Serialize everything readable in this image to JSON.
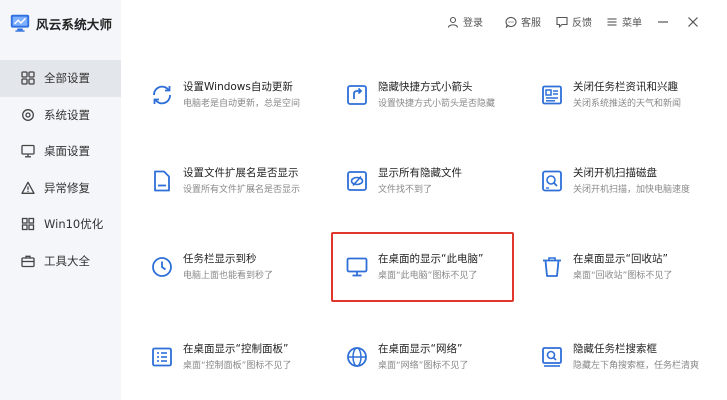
{
  "app": {
    "title": "风云系统大师",
    "brand_color": "#2f6fe0"
  },
  "topbar": {
    "login": "登录",
    "service": "客服",
    "feedback": "反馈",
    "menu": "菜单"
  },
  "sidebar": {
    "items": [
      {
        "label": "全部设置",
        "icon": "grid-icon",
        "active": true
      },
      {
        "label": "系统设置",
        "icon": "gear-icon",
        "active": false
      },
      {
        "label": "桌面设置",
        "icon": "monitor-icon",
        "active": false
      },
      {
        "label": "异常修复",
        "icon": "warning-icon",
        "active": false
      },
      {
        "label": "Win10优化",
        "icon": "windows-icon",
        "active": false
      },
      {
        "label": "工具大全",
        "icon": "toolbox-icon",
        "active": false
      }
    ]
  },
  "cards": [
    {
      "title": "设置Windows自动更新",
      "desc": "电脑老是自动更新，总是空间",
      "icon": "refresh-icon"
    },
    {
      "title": "隐藏快捷方式小箭头",
      "desc": "设置快捷方式小箭头是否隐藏",
      "icon": "shortcut-arrow-icon"
    },
    {
      "title": "关闭任务栏资讯和兴趣",
      "desc": "关闭系统推送的天气和新闻",
      "icon": "news-icon"
    },
    {
      "title": "设置文件扩展名是否显示",
      "desc": "设置所有文件扩展名是否显示",
      "icon": "file-icon"
    },
    {
      "title": "显示所有隐藏文件",
      "desc": "文件找不到了",
      "icon": "hidden-file-icon"
    },
    {
      "title": "关闭开机扫描磁盘",
      "desc": "关闭开机扫描，加快电脑速度",
      "icon": "disk-scan-icon"
    },
    {
      "title": "任务栏显示到秒",
      "desc": "电脑上面也能看到秒了",
      "icon": "clock-icon"
    },
    {
      "title": "在桌面的显示“此电脑”",
      "desc": "桌面“此电脑”图标不见了",
      "icon": "this-pc-icon"
    },
    {
      "title": "在桌面显示“回收站”",
      "desc": "桌面“回收站”图标不见了",
      "icon": "recycle-bin-icon"
    },
    {
      "title": "在桌面显示“控制面板”",
      "desc": "桌面“控制面板”图标不见了",
      "icon": "control-panel-icon"
    },
    {
      "title": "在桌面显示“网络”",
      "desc": "桌面“网络”图标不见了",
      "icon": "network-icon"
    },
    {
      "title": "隐藏任务栏搜索框",
      "desc": "隐藏左下角搜索框，任务栏清爽",
      "icon": "search-box-icon"
    }
  ],
  "highlight_color": "#e0362c"
}
